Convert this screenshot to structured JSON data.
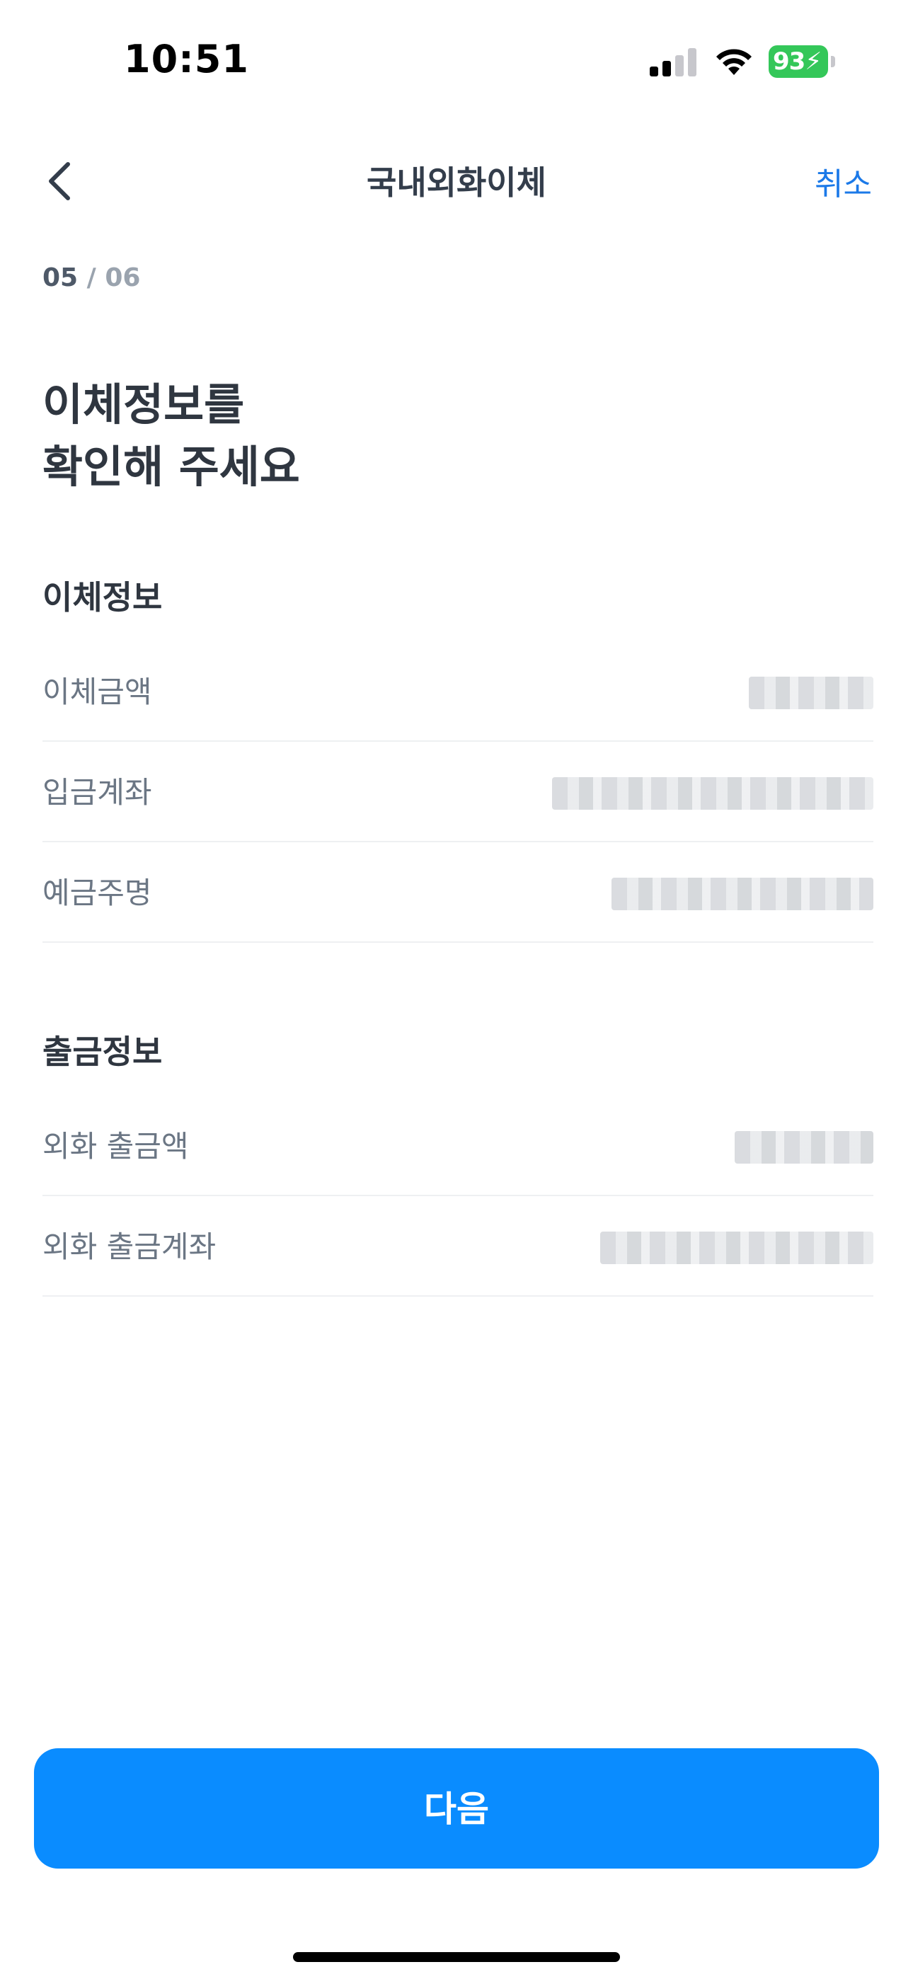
{
  "status_bar": {
    "time": "10:51",
    "battery": "93"
  },
  "nav": {
    "title": "국내외화이체",
    "cancel": "취소"
  },
  "step": {
    "current": "05",
    "separator": " / ",
    "total": "06"
  },
  "headline": {
    "line1": "이체정보를",
    "line2": "확인해 주세요"
  },
  "transfer_info": {
    "title": "이체정보",
    "rows": [
      {
        "label": "이체금액",
        "value": ""
      },
      {
        "label": "입금계좌",
        "value": ""
      },
      {
        "label": "예금주명",
        "value": ""
      }
    ]
  },
  "withdrawal_info": {
    "title": "출금정보",
    "rows": [
      {
        "label": "외화 출금액",
        "value": ""
      },
      {
        "label": "외화 출금계좌",
        "value": ""
      }
    ]
  },
  "next_button": "다음",
  "colors": {
    "accent": "#0a8cff",
    "link": "#1b79e8",
    "battery": "#34c759"
  }
}
